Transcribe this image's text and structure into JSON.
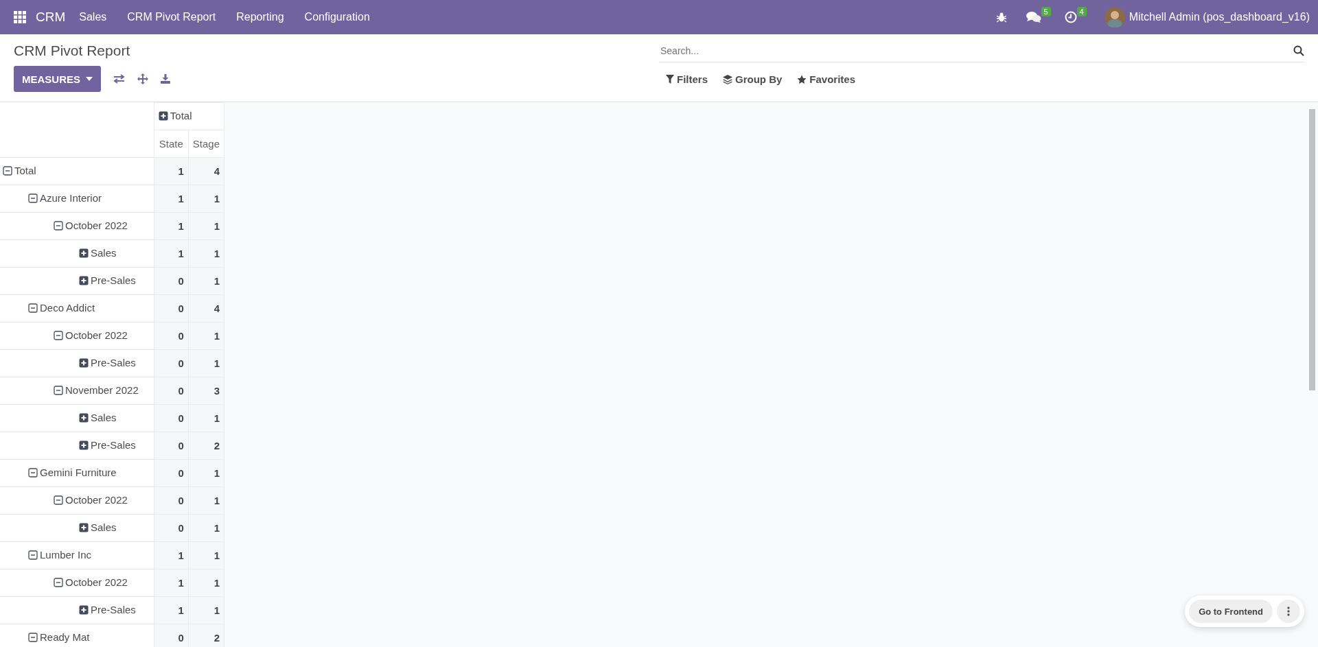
{
  "navbar": {
    "app": "CRM",
    "menu": [
      "Sales",
      "CRM Pivot Report",
      "Reporting",
      "Configuration"
    ],
    "messages_badge": "5",
    "activities_badge": "4",
    "user": "Mitchell Admin (pos_dashboard_v16)"
  },
  "page_title": "CRM Pivot Report",
  "search": {
    "placeholder": "Search..."
  },
  "toolbar": {
    "measures": "MEASURES"
  },
  "search_options": [
    "Filters",
    "Group By",
    "Favorites"
  ],
  "pivot": {
    "column_header": {
      "label": "Total",
      "expanded": false
    },
    "measures": [
      "State",
      "Stage"
    ],
    "rows": [
      {
        "label": "Total",
        "expanded": true,
        "values": [
          "1",
          "4"
        ],
        "children": [
          {
            "label": "Azure Interior",
            "expanded": true,
            "values": [
              "1",
              "1"
            ],
            "children": [
              {
                "label": "October 2022",
                "expanded": true,
                "values": [
                  "1",
                  "1"
                ],
                "children": [
                  {
                    "label": "Sales",
                    "expanded": false,
                    "values": [
                      "1",
                      "1"
                    ]
                  },
                  {
                    "label": "Pre-Sales",
                    "expanded": false,
                    "values": [
                      "0",
                      "1"
                    ]
                  }
                ]
              }
            ]
          },
          {
            "label": "Deco Addict",
            "expanded": true,
            "values": [
              "0",
              "4"
            ],
            "children": [
              {
                "label": "October 2022",
                "expanded": true,
                "values": [
                  "0",
                  "1"
                ],
                "children": [
                  {
                    "label": "Pre-Sales",
                    "expanded": false,
                    "values": [
                      "0",
                      "1"
                    ]
                  }
                ]
              },
              {
                "label": "November 2022",
                "expanded": true,
                "values": [
                  "0",
                  "3"
                ],
                "children": [
                  {
                    "label": "Sales",
                    "expanded": false,
                    "values": [
                      "0",
                      "1"
                    ]
                  },
                  {
                    "label": "Pre-Sales",
                    "expanded": false,
                    "values": [
                      "0",
                      "2"
                    ]
                  }
                ]
              }
            ]
          },
          {
            "label": "Gemini Furniture",
            "expanded": true,
            "values": [
              "0",
              "1"
            ],
            "children": [
              {
                "label": "October 2022",
                "expanded": true,
                "values": [
                  "0",
                  "1"
                ],
                "children": [
                  {
                    "label": "Sales",
                    "expanded": false,
                    "values": [
                      "0",
                      "1"
                    ]
                  }
                ]
              }
            ]
          },
          {
            "label": "Lumber Inc",
            "expanded": true,
            "values": [
              "1",
              "1"
            ],
            "children": [
              {
                "label": "October 2022",
                "expanded": true,
                "values": [
                  "1",
                  "1"
                ],
                "children": [
                  {
                    "label": "Pre-Sales",
                    "expanded": false,
                    "values": [
                      "1",
                      "1"
                    ]
                  }
                ]
              }
            ]
          },
          {
            "label": "Ready Mat",
            "expanded": true,
            "values": [
              "0",
              "2"
            ]
          }
        ]
      }
    ]
  },
  "frontend_button": "Go to Frontend"
}
